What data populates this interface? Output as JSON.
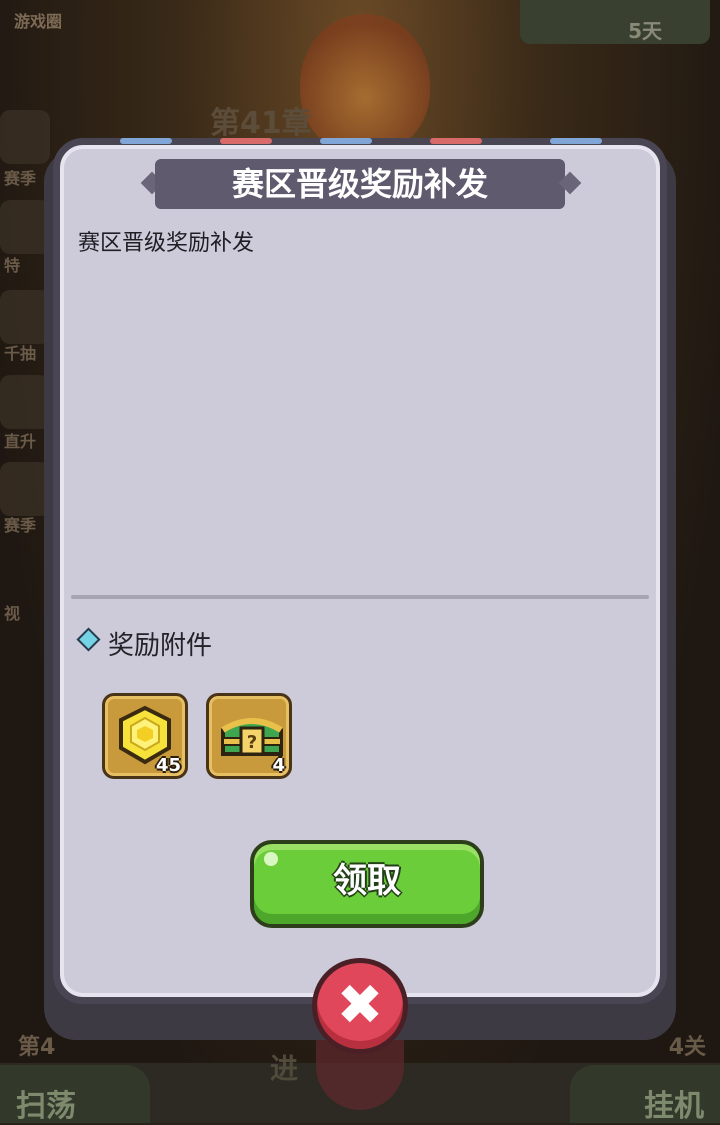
{
  "background": {
    "top_left_label": "游戏圈",
    "top_right_label": "5天",
    "chapter_label": "第41章",
    "left_side_labels": [
      "赛季",
      "特",
      "千抽",
      "直升",
      "赛季",
      "视"
    ],
    "floor_left": "第4",
    "floor_right": "4关",
    "bottom_left_button": "扫荡",
    "bottom_center_label": "进",
    "bottom_right_button": "挂机"
  },
  "dialog": {
    "title": "赛区晋级奖励补发",
    "message": "赛区晋级奖励补发",
    "attachments_title": "奖励附件",
    "attachments": [
      {
        "icon": "gold-gem-icon",
        "count": "45"
      },
      {
        "icon": "green-chest-icon",
        "count": "4"
      }
    ],
    "claim_label": "领取",
    "close_symbol": "✖"
  },
  "colors": {
    "panel": "#cdcbd9",
    "title_banner": "#5f5a6e",
    "claim_button": "#6ccd3a",
    "close_button": "#e0475a",
    "slot_gold": "#c99a3c"
  }
}
